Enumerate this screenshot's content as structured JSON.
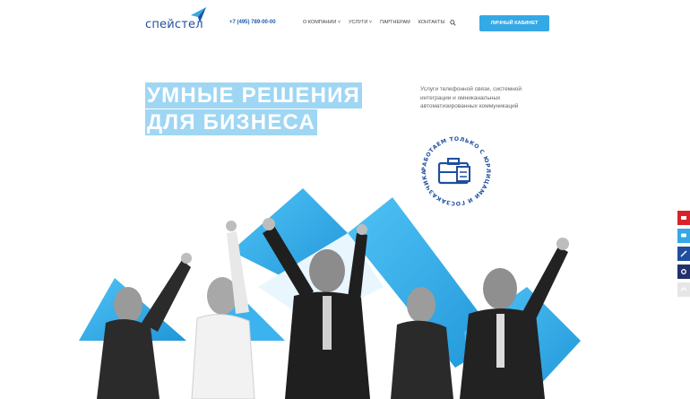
{
  "header": {
    "logo_text": "спейстел",
    "phone": "+7 (495) 789-00-00",
    "nav": [
      {
        "label": "О КОМПАНИИ",
        "has_dropdown": true
      },
      {
        "label": "УСЛУГИ",
        "has_dropdown": true
      },
      {
        "label": "ПАРТНЕРАМ",
        "has_dropdown": false
      },
      {
        "label": "КОНТАКТЫ",
        "has_dropdown": false
      }
    ],
    "cabinet_button": "ЛИЧНЫЙ КАБИНЕТ"
  },
  "hero": {
    "title_line1": "УМНЫЕ РЕШЕНИЯ",
    "title_line2": "ДЛЯ БИЗНЕСА",
    "description": "Услуги телефонной связи, системной интеграции и омниканальных автоматизированных коммуникаций",
    "badge_text": "РАБОТАЕМ ТОЛЬКО С ЮРЛИЦАМИ И ГОСЗАКАЗЧИКАМИ"
  },
  "colors": {
    "accent": "#35a8e6",
    "brand": "#1f4f9e",
    "highlight": "#9fd6f3"
  },
  "side_widgets": [
    {
      "icon": "mail-icon",
      "color": "#d8232a"
    },
    {
      "icon": "chat-icon",
      "color": "#35a8e6"
    },
    {
      "icon": "pen-icon",
      "color": "#1f4f9e"
    },
    {
      "icon": "settings-icon",
      "color": "#22306b"
    },
    {
      "icon": "arrow-up-icon",
      "color": "#e6e6e6"
    }
  ]
}
